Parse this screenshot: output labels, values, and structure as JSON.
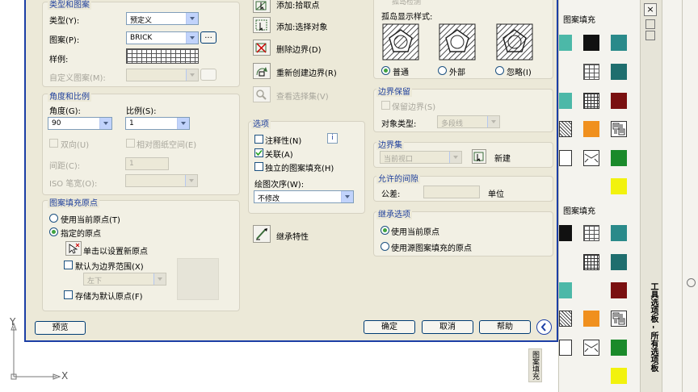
{
  "dialog": {
    "group_type": "类型和图案",
    "type_label": "类型(Y):",
    "type_value": "预定义",
    "pattern_label": "图案(P):",
    "pattern_value": "BRICK",
    "pattern_more": "...",
    "sample_label": "样例:",
    "custom_label": "自定义图案(M):",
    "group_angle": "角度和比例",
    "angle_label": "角度(G):",
    "angle_value": "90",
    "scale_label": "比例(S):",
    "scale_value": "1",
    "double_label": "双向(U)",
    "relative_label": "相对图纸空间(E)",
    "spacing_label": "间距(C):",
    "spacing_value": "1",
    "iso_label": "ISO 笔宽(O):",
    "group_origin": "图案填充原点",
    "use_current": "使用当前原点(T)",
    "specified": "指定的原点",
    "click_set": "单击以设置新原点",
    "default_boundary": "默认为边界范围(X)",
    "corner_value": "左下",
    "store_default": "存储为默认原点(F)",
    "preview": "预览",
    "add_pick": "添加:拾取点",
    "add_select": "添加:选择对象",
    "remove_boundary": "删除边界(D)",
    "recreate_boundary": "重新创建边界(R)",
    "view_selection": "查看选择集(V)",
    "group_options": "选项",
    "annotative": "注释性(N)",
    "info_icon": "i",
    "associative": "关联(A)",
    "separate": "独立的图案填充(H)",
    "draw_order_label": "绘图次序(W):",
    "draw_order_value": "不修改",
    "inherit": "继承特性",
    "island_detect": "孤岛检测",
    "island_style_label": "孤岛显示样式:",
    "island_normal": "普通",
    "island_outer": "外部",
    "island_ignore": "忽略(I)",
    "group_retain": "边界保留",
    "retain_boundary": "保留边界(S)",
    "object_type_label": "对象类型:",
    "object_type_value": "多段线",
    "group_set": "边界集",
    "set_value": "当前视口",
    "new_label": "新建",
    "group_gap": "允许的间隙",
    "tolerance_label": "公差:",
    "tolerance_unit": "单位",
    "group_inherit": "继承选项",
    "inherit_current": "使用当前原点",
    "inherit_source": "使用源图案填充的原点",
    "ok": "确定",
    "cancel": "取消",
    "help": "帮助"
  },
  "palette": {
    "header1": "图案填充",
    "header2": "图案填充",
    "vertical_title": "工具选项板 - 所有选项板",
    "vertical_tab": "图案填充",
    "close": "×",
    "colors": {
      "teal": "#2a8a8a",
      "darkteal": "#1f6e6e",
      "maroon": "#7a1010",
      "orange": "#f0901e",
      "green": "#1a8a2a",
      "yellow": "#f2f20e",
      "black": "#111111",
      "aqua": "#4cb8a8"
    }
  },
  "ucs": {
    "x": "X",
    "y": "Y"
  }
}
